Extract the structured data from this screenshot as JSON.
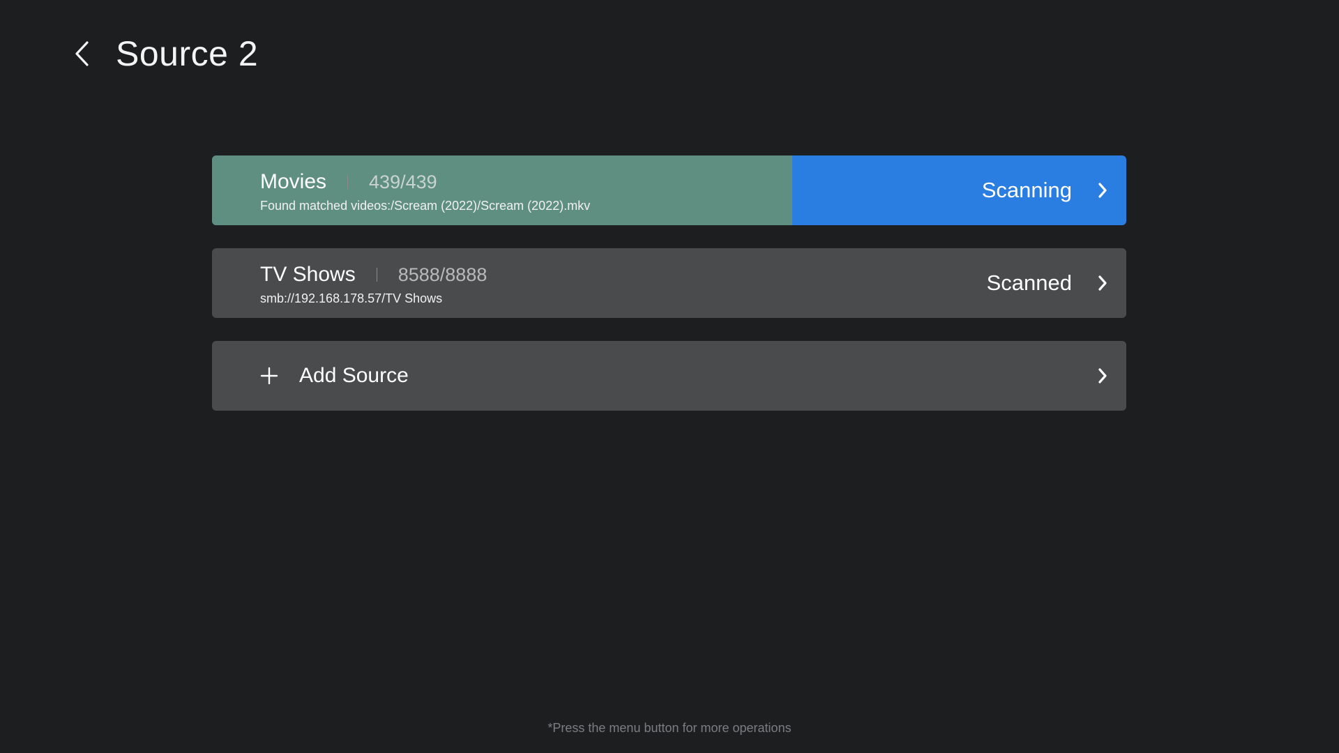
{
  "header": {
    "title": "Source 2",
    "back_icon": "chevron-left-icon"
  },
  "sources": [
    {
      "name": "Movies",
      "count": "439/439",
      "detail": "Found matched videos:/Scream (2022)/Scream (2022).mkv",
      "status": "Scanning",
      "progress_fraction": 0.635,
      "focused": true
    },
    {
      "name": "TV Shows",
      "count": "8588/8888",
      "detail": "smb://192.168.178.57/TV Shows",
      "status": "Scanned",
      "focused": false
    }
  ],
  "add_source": {
    "label": "Add Source",
    "icon": "plus-icon"
  },
  "footer": {
    "hint": "*Press the menu button for more operations"
  },
  "colors": {
    "background": "#1d1e20",
    "row": "#4a4b4d",
    "focus_blue": "#2a7de1",
    "progress_green": "#5f8f80"
  }
}
